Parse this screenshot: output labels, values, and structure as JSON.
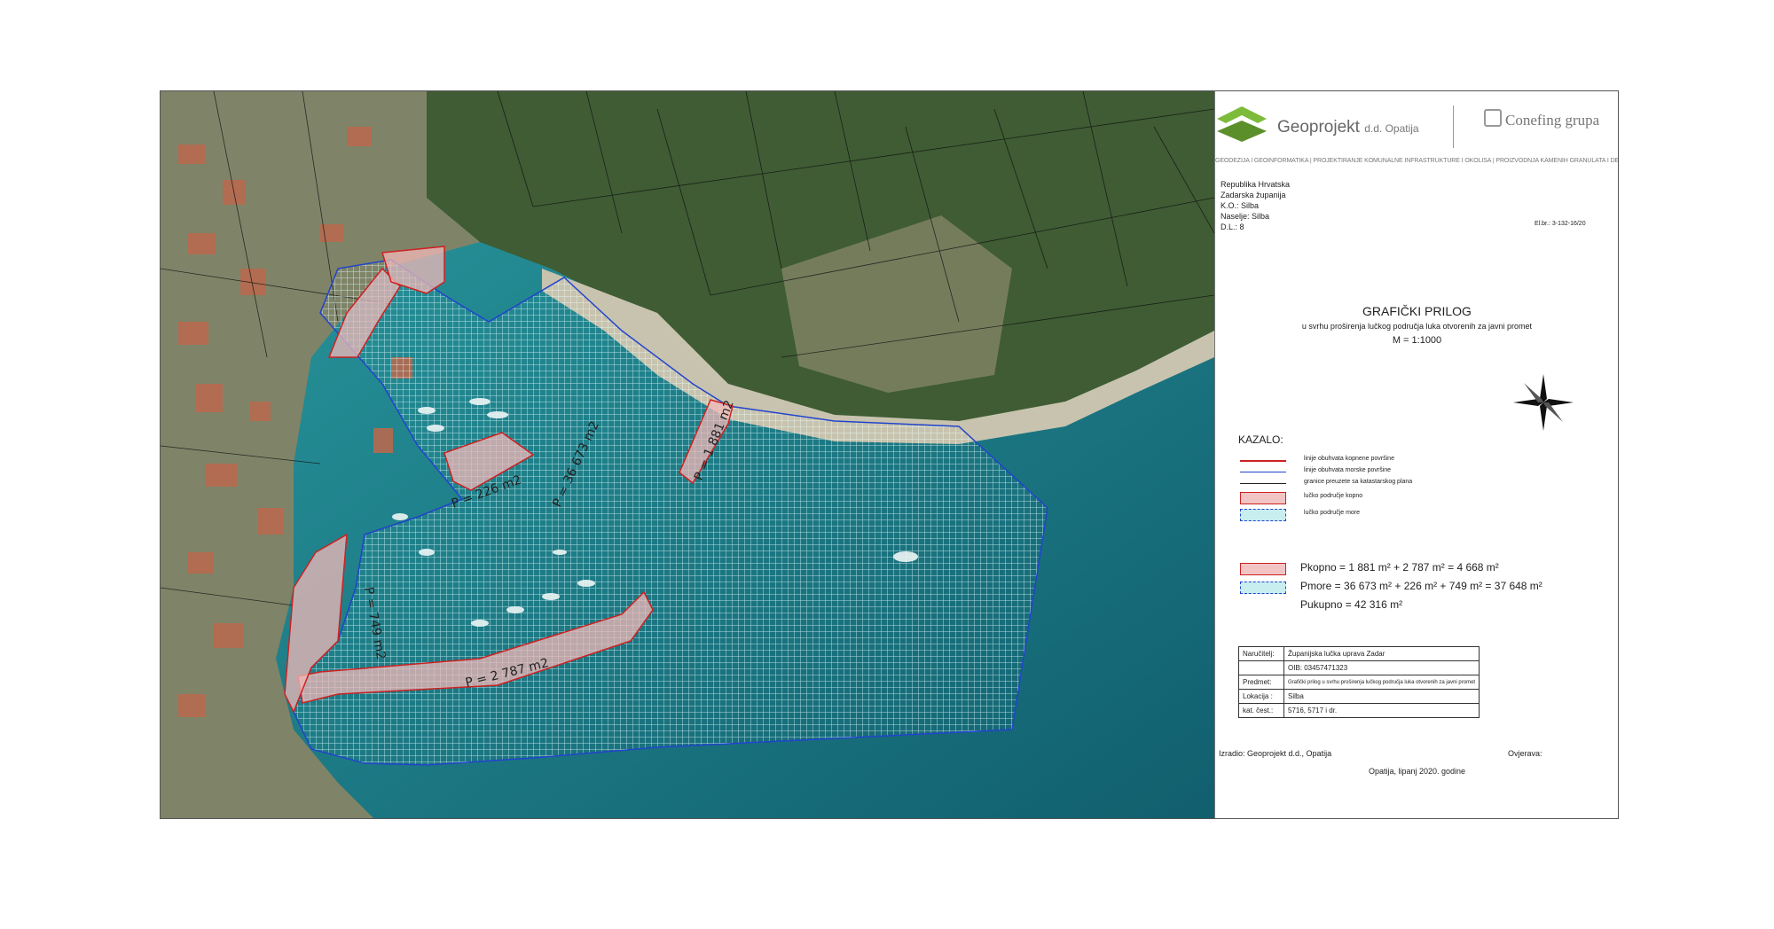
{
  "header": {
    "company": "Geoprojekt",
    "company_suffix": "d.d. Opatija",
    "partner": "Conefing grupa",
    "services": "GEODEZIJA I GEOINFORMATIKA | PROJEKTIRANJE KOMUNALNE INFRASTRUKTURE I OKOLIŠA | PROIZVODNJA KAMENIH GRANULATA I DEKORATIVNOG KAMENA"
  },
  "location": {
    "line1": "Republika Hrvatska",
    "line2": "Zadarska županija",
    "line3": "K.O.: Silba",
    "line4": "Naselje: Silba",
    "line5": "D.L.: 8",
    "ref": "El.br.: 3-132-16/20"
  },
  "title": {
    "main": "GRAFIČKI PRILOG",
    "subtitle": "u svrhu proširenja lučkog područja luka otvorenih za javni promet",
    "scale": "M = 1:1000"
  },
  "legend": {
    "heading": "KAZALO:",
    "items": [
      {
        "label": "linije obuhvata kopnene površine",
        "color": "#cc2222",
        "kind": "line"
      },
      {
        "label": "linije obuhvata morske površine",
        "color": "#2244cc",
        "kind": "line"
      },
      {
        "label": "granice preuzete sa katastarskog plana",
        "color": "#222222",
        "kind": "line"
      },
      {
        "label": "lučko područje kopno",
        "color": "#f2c4c4",
        "kind": "fill"
      },
      {
        "label": "lučko područje more",
        "color": "#c8eef0",
        "kind": "fill"
      }
    ]
  },
  "areas": {
    "land": "Pkopno = 1 881 m² + 2 787 m² = 4 668 m²",
    "sea": "Pmore = 36 673 m² + 226 m² + 749 m² = 37 648 m²",
    "total": "Pukupno = 42 316 m²"
  },
  "meta": [
    {
      "key": "Naručitelj:",
      "value": "Županijska lučka uprava Zadar"
    },
    {
      "key": "",
      "value": "OIB: 03457471323"
    },
    {
      "key": "Predmet:",
      "value": "Grafički prilog u svrhu proširenja lučkog područja luka otvorenih za javni promet"
    },
    {
      "key": "Lokacija :",
      "value": "Silba"
    },
    {
      "key": "kat. čest.:",
      "value": "5716, 5717 i dr."
    }
  ],
  "footer": {
    "made_by": "Izradio: Geoprojekt d.d., Opatija",
    "verified": "Ovjerava:",
    "place_date": "Opatija, lipanj 2020. godine"
  },
  "map_labels": {
    "sea_main": "P = 36 673 m2",
    "land_north": "P = 1 881 m2",
    "land_south": "P = 2 787 m2",
    "sea_small1": "P = 226 m2",
    "sea_small2": "P = 749 m2"
  },
  "colors": {
    "land_fill": "#f2b8b8",
    "land_border": "#cc2222",
    "sea_border": "#2244cc",
    "sea_hatch": "#e8ffff",
    "water": "#1b7f8a",
    "vegetation": "#3a5a30"
  },
  "icons": {
    "north_arrow": "compass-rose-icon",
    "logo": "geoprojekt-logo-icon"
  }
}
